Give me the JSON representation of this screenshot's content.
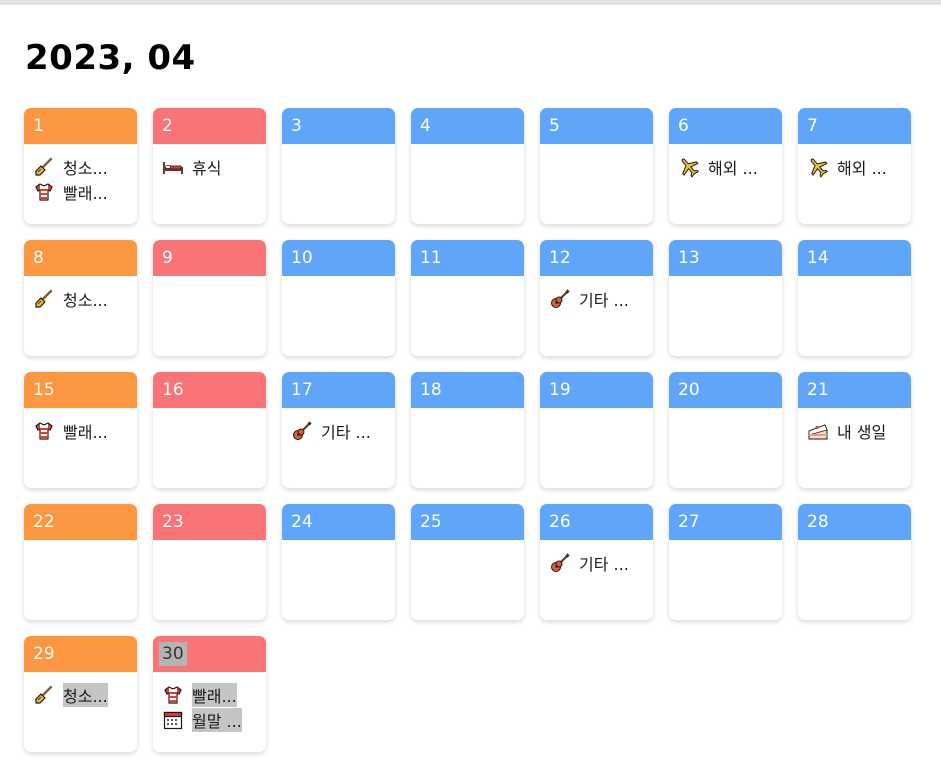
{
  "header": {
    "title": "2023, 04"
  },
  "colors": {
    "saturday": "#fc9640",
    "sunday": "#f87476",
    "weekday": "#5fa5fa"
  },
  "days": [
    {
      "num": "1",
      "type": "saturday",
      "events": [
        {
          "icon": "broom-icon",
          "label": "청소..."
        },
        {
          "icon": "shirt-icon",
          "label": "빨래..."
        }
      ]
    },
    {
      "num": "2",
      "type": "sunday",
      "events": [
        {
          "icon": "bed-icon",
          "label": "휴식"
        }
      ]
    },
    {
      "num": "3",
      "type": "weekday",
      "events": []
    },
    {
      "num": "4",
      "type": "weekday",
      "events": []
    },
    {
      "num": "5",
      "type": "weekday",
      "events": []
    },
    {
      "num": "6",
      "type": "weekday",
      "events": [
        {
          "icon": "airplane-icon",
          "label": "해외 ..."
        }
      ]
    },
    {
      "num": "7",
      "type": "weekday",
      "events": [
        {
          "icon": "airplane-icon",
          "label": "해외 ..."
        }
      ]
    },
    {
      "num": "8",
      "type": "saturday",
      "events": [
        {
          "icon": "broom-icon",
          "label": "청소..."
        }
      ]
    },
    {
      "num": "9",
      "type": "sunday",
      "events": []
    },
    {
      "num": "10",
      "type": "weekday",
      "events": []
    },
    {
      "num": "11",
      "type": "weekday",
      "events": []
    },
    {
      "num": "12",
      "type": "weekday",
      "events": [
        {
          "icon": "guitar-icon",
          "label": "기타 ..."
        }
      ]
    },
    {
      "num": "13",
      "type": "weekday",
      "events": []
    },
    {
      "num": "14",
      "type": "weekday",
      "events": []
    },
    {
      "num": "15",
      "type": "saturday",
      "events": [
        {
          "icon": "shirt-icon",
          "label": "빨래..."
        }
      ]
    },
    {
      "num": "16",
      "type": "sunday",
      "events": []
    },
    {
      "num": "17",
      "type": "weekday",
      "events": [
        {
          "icon": "guitar-icon",
          "label": "기타 ..."
        }
      ]
    },
    {
      "num": "18",
      "type": "weekday",
      "events": []
    },
    {
      "num": "19",
      "type": "weekday",
      "events": []
    },
    {
      "num": "20",
      "type": "weekday",
      "events": []
    },
    {
      "num": "21",
      "type": "weekday",
      "events": [
        {
          "icon": "cake-icon",
          "label": "내 생일"
        }
      ]
    },
    {
      "num": "22",
      "type": "saturday",
      "events": []
    },
    {
      "num": "23",
      "type": "sunday",
      "events": []
    },
    {
      "num": "24",
      "type": "weekday",
      "events": []
    },
    {
      "num": "25",
      "type": "weekday",
      "events": []
    },
    {
      "num": "26",
      "type": "weekday",
      "events": [
        {
          "icon": "guitar-icon",
          "label": "기타 ..."
        }
      ]
    },
    {
      "num": "27",
      "type": "weekday",
      "events": []
    },
    {
      "num": "28",
      "type": "weekday",
      "events": []
    },
    {
      "num": "29",
      "type": "saturday",
      "events": [
        {
          "icon": "broom-icon",
          "label": "청소...",
          "selected": true
        }
      ]
    },
    {
      "num": "30",
      "type": "sunday",
      "num_selected": true,
      "events": [
        {
          "icon": "shirt-icon",
          "label": "빨래...",
          "selected": true
        },
        {
          "icon": "calendar-icon",
          "label": "월말 ...",
          "selected": true
        }
      ]
    }
  ]
}
